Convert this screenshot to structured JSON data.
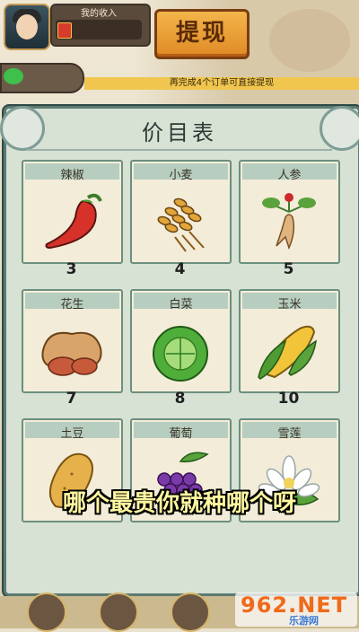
{
  "header": {
    "income_label": "我的收入",
    "withdraw_label": "提现",
    "notice_text": "再完成4个订单可直接提现"
  },
  "panel": {
    "title": "价目表"
  },
  "items": [
    {
      "name": "辣椒",
      "price": "3",
      "icon": "chili-pepper-icon"
    },
    {
      "name": "小麦",
      "price": "4",
      "icon": "wheat-icon"
    },
    {
      "name": "人参",
      "price": "5",
      "icon": "ginseng-icon"
    },
    {
      "name": "花生",
      "price": "7",
      "icon": "peanut-icon"
    },
    {
      "name": "白菜",
      "price": "8",
      "icon": "cabbage-icon"
    },
    {
      "name": "玉米",
      "price": "10",
      "icon": "corn-icon"
    },
    {
      "name": "土豆",
      "price": "",
      "icon": "potato-icon"
    },
    {
      "name": "葡萄",
      "price": "",
      "icon": "grape-icon"
    },
    {
      "name": "雪莲",
      "price": "",
      "icon": "snow-lotus-icon"
    }
  ],
  "caption": "哪个最贵你就种哪个呀",
  "watermark": {
    "main": "962.NET",
    "sub": "乐游网"
  },
  "colors": {
    "accent": "#e08a25",
    "panel": "#d7e1d4",
    "card": "#f3ecd8",
    "caption": "#fff7a0"
  }
}
